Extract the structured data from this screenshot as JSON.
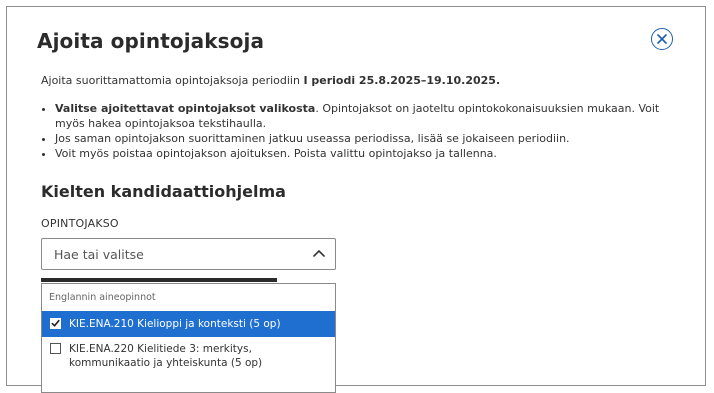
{
  "dialog": {
    "title": "Ajoita opintojaksoja",
    "intro_prefix": "Ajoita suorittamattomia opintojaksoja periodiin",
    "intro_period": "I periodi 25.8.2025–19.10.2025.",
    "instructions": [
      {
        "strong": "Valitse ajoitettavat opintojaksot valikosta",
        "text": ". Opintojaksot on jaoteltu opintokokonaisuuksien mukaan. Voit myös hakea opintojaksoa tekstihaulla."
      },
      {
        "strong": "",
        "text": "Jos saman opintojakson suorittaminen jatkuu useassa periodissa, lisää se jokaiseen periodiin."
      },
      {
        "strong": "",
        "text": "Voit myös poistaa opintojakson ajoituksen. Poista valittu opintojakso ja tallenna."
      }
    ]
  },
  "program": {
    "title": "Kielten kandidaattiohjelma",
    "field_label": "OPINTOJAKSO",
    "search_placeholder": "Hae tai valitse"
  },
  "dropdown": {
    "group_label": "Englannin aineopinnot",
    "options": [
      {
        "label": "KIE.ENA.210 Kielioppi ja konteksti (5 op)",
        "checked": true
      },
      {
        "label": "KIE.ENA.220 Kielitiede 3: merkitys, kommunikaatio ja yhteiskunta (5 op)",
        "checked": false
      }
    ]
  },
  "colors": {
    "accent": "#1f6fd1",
    "close_icon": "#1f5fae",
    "border": "#8a8a8a"
  },
  "icons": [
    "close-icon",
    "chevron-up-icon",
    "checkbox-checked-icon",
    "checkbox-empty-icon"
  ]
}
